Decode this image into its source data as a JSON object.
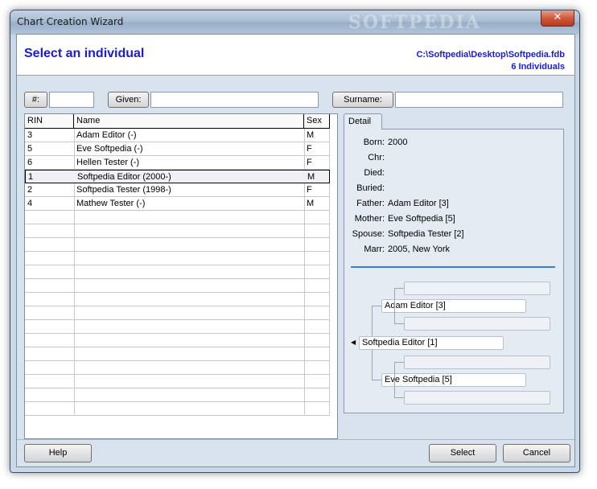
{
  "window": {
    "title": "Chart Creation Wizard",
    "watermark": "SOFTPEDIA",
    "close_glyph": "✕"
  },
  "header": {
    "title": "Select an individual",
    "file_path": "C:\\Softpedia\\Desktop\\Softpedia.fdb",
    "count": "6 Individuals"
  },
  "filters": {
    "number_label": "#:",
    "number_value": "",
    "given_label": "Given:",
    "given_value": "",
    "surname_label": "Surname:",
    "surname_value": ""
  },
  "grid": {
    "columns": [
      "RIN",
      "Name",
      "Sex"
    ],
    "rows": [
      {
        "rin": "3",
        "name": "Adam Editor (-)",
        "sex": "M"
      },
      {
        "rin": "5",
        "name": "Eve Softpedia (-)",
        "sex": "F"
      },
      {
        "rin": "6",
        "name": "Hellen Tester (-)",
        "sex": "F"
      },
      {
        "rin": "1",
        "name": "Softpedia Editor (2000-)",
        "sex": "M"
      },
      {
        "rin": "2",
        "name": "Softpedia Tester (1998-)",
        "sex": "F"
      },
      {
        "rin": "4",
        "name": "Mathew Tester (-)",
        "sex": "M"
      }
    ],
    "selected_row": 3
  },
  "detail": {
    "tab_label": "Detail",
    "fields": [
      {
        "label": "Born:",
        "value": "2000"
      },
      {
        "label": "Chr:",
        "value": ""
      },
      {
        "label": "Died:",
        "value": ""
      },
      {
        "label": "Buried:",
        "value": ""
      },
      {
        "label": "Father:",
        "value": "Adam Editor [3]"
      },
      {
        "label": "Mother:",
        "value": "Eve Softpedia [5]"
      },
      {
        "label": "Spouse:",
        "value": "Softpedia Tester [2]"
      },
      {
        "label": "Marr:",
        "value": "2005, New York"
      }
    ],
    "pedigree": {
      "subject": "Softpedia Editor [1]",
      "father": "Adam Editor [3]",
      "mother": "Eve Softpedia [5]"
    }
  },
  "buttons": {
    "help": "Help",
    "select": "Select",
    "cancel": "Cancel"
  },
  "colors": {
    "accent": "#1a1adf",
    "separator": "#3a7fd0"
  }
}
